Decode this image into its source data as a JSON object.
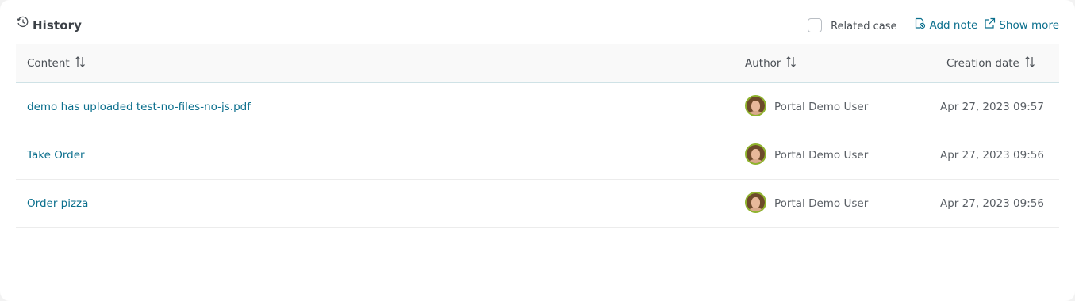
{
  "header": {
    "title": "History",
    "related_case_label": "Related case",
    "add_note_label": "Add note",
    "show_more_label": "Show more"
  },
  "table": {
    "columns": {
      "content": "Content",
      "author": "Author",
      "creation_date": "Creation date"
    },
    "rows": [
      {
        "content": "demo has uploaded test-no-files-no-js.pdf",
        "author": "Portal Demo User",
        "date": "Apr 27, 2023 09:57"
      },
      {
        "content": "Take Order",
        "author": "Portal Demo User",
        "date": "Apr 27, 2023 09:56"
      },
      {
        "content": "Order pizza",
        "author": "Portal Demo User",
        "date": "Apr 27, 2023 09:56"
      }
    ]
  },
  "colors": {
    "link": "#0b6f8d",
    "title": "#3b4046",
    "avatar_ring": "#8fb32e"
  },
  "icons": {
    "title": "history-icon",
    "add_note": "note-add-icon",
    "show_more": "external-link-icon",
    "sort": "sort-icon"
  }
}
